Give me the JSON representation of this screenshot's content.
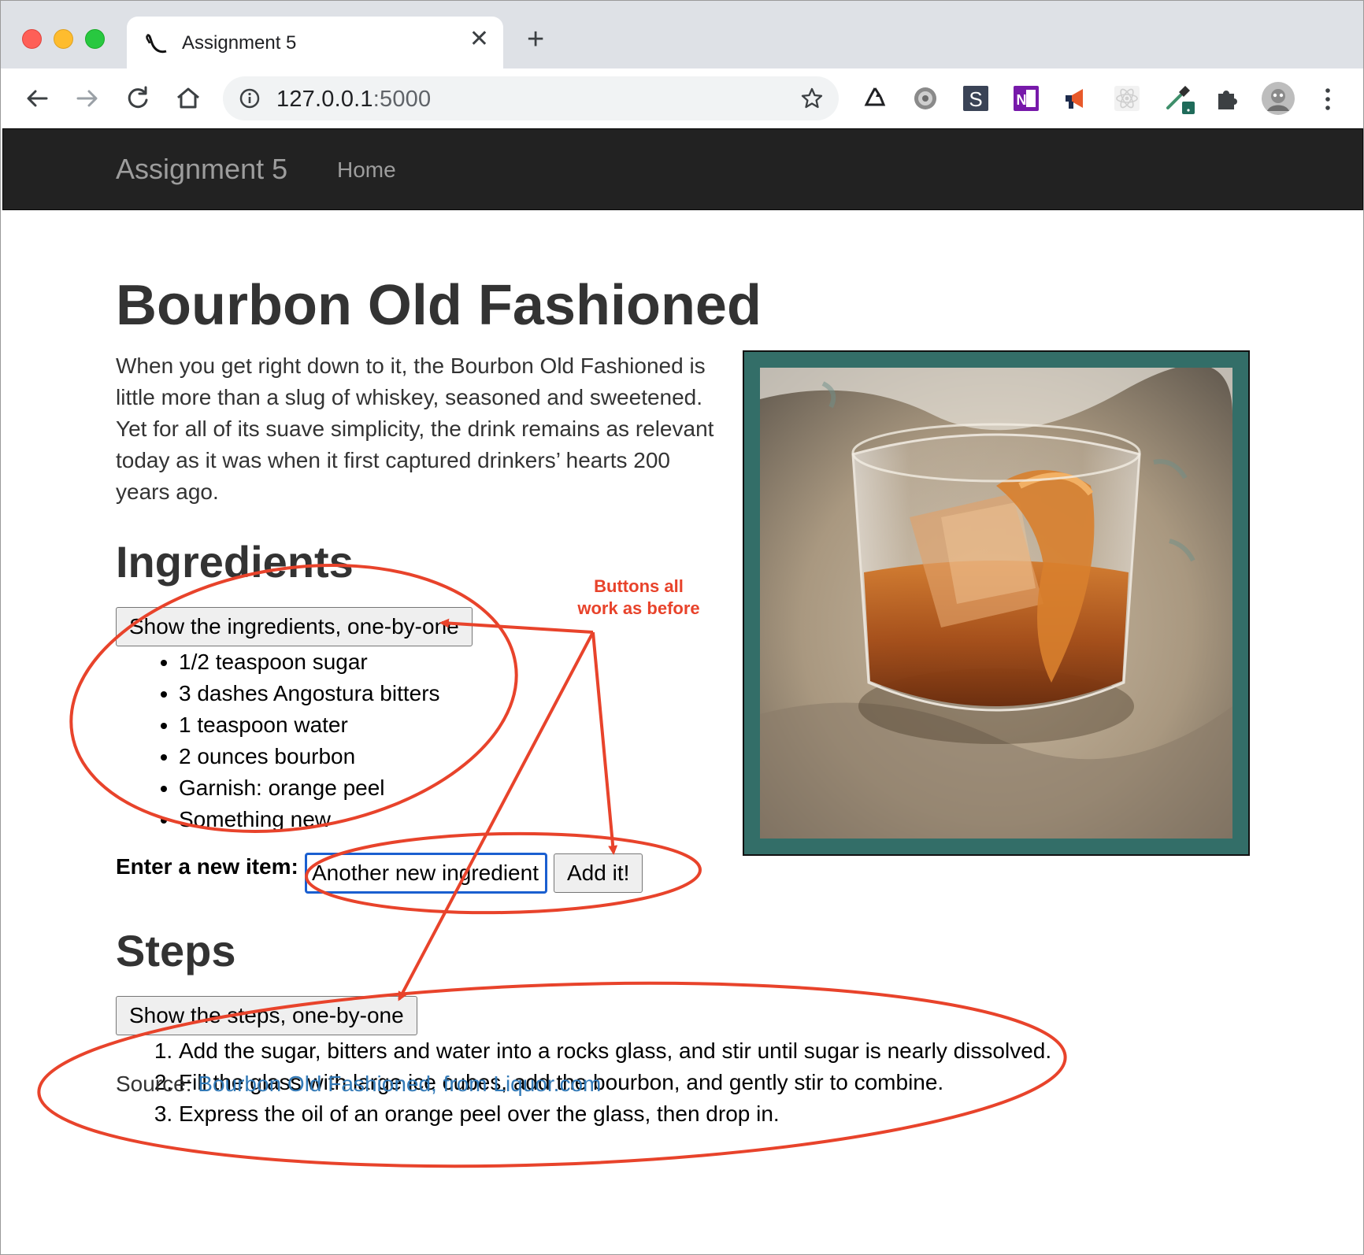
{
  "browser": {
    "tab_title": "Assignment 5",
    "url_host": "127.0.0.1",
    "url_port": ":5000",
    "extension_icons": [
      "recycle-extension-icon",
      "gear-extension-icon",
      "s-extension-icon",
      "onenote-extension-icon",
      "megaphone-extension-icon",
      "react-devtools-icon",
      "eyedropper-extension-icon",
      "puzzle-extensions-icon",
      "profile-avatar"
    ]
  },
  "navbar": {
    "brand": "Assignment 5",
    "home_link": "Home"
  },
  "page": {
    "title": "Bourbon Old Fashioned",
    "intro": "When you get right down to it, the Bourbon Old Fashioned is little more than a slug of whiskey, seasoned and sweetened. Yet for all of its suave simplicity, the drink remains as relevant today as it was when it first captured drinkers’ hearts 200 years ago.",
    "ingredients_heading": "Ingredients",
    "ingredients_button": "Show the ingredients, one-by-one",
    "ingredients": [
      "1/2 teaspoon sugar",
      "3 dashes Angostura bitters",
      "1 teaspoon water",
      "2 ounces bourbon",
      "Garnish: orange peel",
      "Something new"
    ],
    "new_item_label": "Enter a new item:",
    "new_item_value": "Another new ingredient",
    "add_button": "Add it!",
    "steps_heading": "Steps",
    "steps_button": "Show the steps, one-by-one",
    "steps": [
      "Add the sugar, bitters and water into a rocks glass, and stir until sugar is nearly dissolved.",
      "Fill the glass with large ice cubes, add the bourbon, and gently stir to combine.",
      "Express the oil of an orange peel over the glass, then drop in."
    ],
    "source_label": "Source:",
    "source_link": "Bourbon Old Fashioned, from Liquor.com"
  },
  "annotation": {
    "line1": "Buttons all",
    "line2": "work as before",
    "color": "#e8432b"
  },
  "colors": {
    "navbar_bg": "#222222",
    "frame": "#336e68",
    "link": "#337ab7"
  }
}
